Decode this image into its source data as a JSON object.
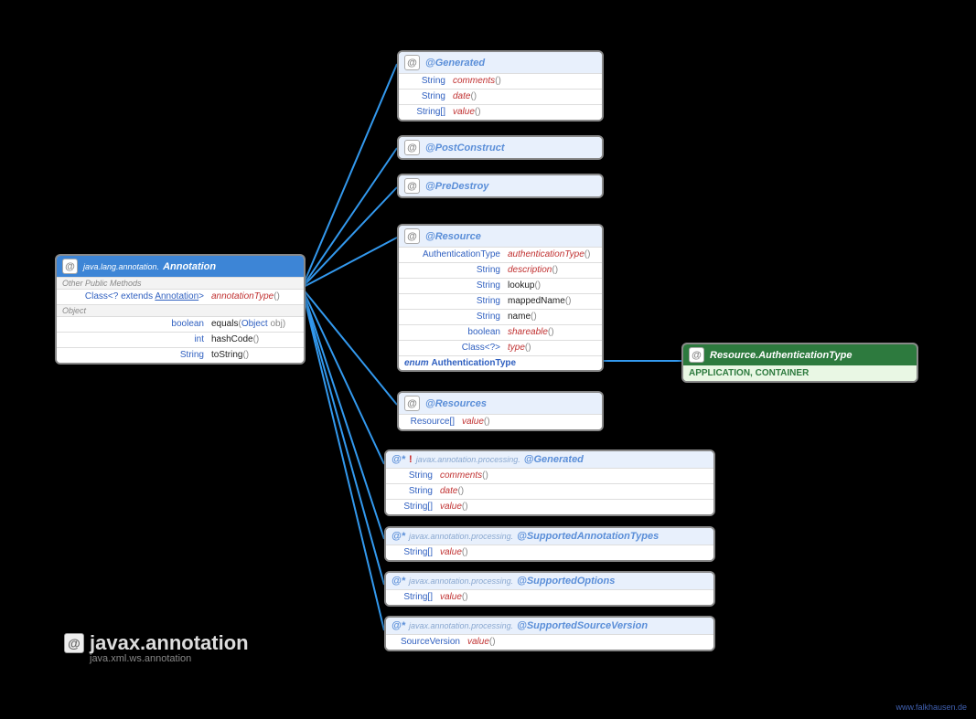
{
  "root": {
    "pkg": "java.lang.annotation.",
    "name": "Annotation",
    "section1": "Other Public Methods",
    "rows1": [
      {
        "type_pre": "Class<? extends ",
        "type_link": "Annotation",
        "type_post": ">",
        "name": "annotationType",
        "name_style": "red",
        "args": "()"
      }
    ],
    "section2": "Object",
    "rows2": [
      {
        "type": "boolean",
        "name": "equals",
        "args_pre": "(",
        "args_link": "Object",
        "args_post": " obj)"
      },
      {
        "type": "int",
        "name": "hashCode",
        "args": "()"
      },
      {
        "type": "String",
        "name": "toString",
        "args": "()"
      }
    ]
  },
  "generated": {
    "name": "@Generated",
    "rows": [
      {
        "type": "String",
        "name": "comments",
        "args": "()",
        "ns": "red"
      },
      {
        "type": "String",
        "name": "date",
        "args": "()",
        "ns": "red"
      },
      {
        "type": "String[]",
        "name": "value",
        "args": "()",
        "ns": "red"
      }
    ]
  },
  "postconstruct": {
    "name": "@PostConstruct"
  },
  "predestroy": {
    "name": "@PreDestroy"
  },
  "resource": {
    "name": "@Resource",
    "rows": [
      {
        "type": "AuthenticationType",
        "name": "authenticationType",
        "args": "()",
        "ns": "red"
      },
      {
        "type": "String",
        "name": "description",
        "args": "()",
        "ns": "red"
      },
      {
        "type": "String",
        "name": "lookup",
        "args": "()"
      },
      {
        "type": "String",
        "name": "mappedName",
        "args": "()"
      },
      {
        "type": "String",
        "name": "name",
        "args": "()"
      },
      {
        "type": "boolean",
        "name": "shareable",
        "args": "()",
        "ns": "red"
      },
      {
        "type": "Class<?>",
        "name": "type",
        "args": "()",
        "ns": "red"
      }
    ],
    "enum_kw": "enum",
    "enum_name": "AuthenticationType"
  },
  "authtype": {
    "name": "Resource.AuthenticationType",
    "values": "APPLICATION, CONTAINER"
  },
  "resources": {
    "name": "@Resources",
    "rows": [
      {
        "type": "Resource[]",
        "name": "value",
        "args": "()",
        "ns": "red"
      }
    ]
  },
  "pgen": {
    "pkg": "javax.annotation.processing.",
    "name": "@Generated",
    "bang": "!",
    "rows": [
      {
        "type": "String",
        "name": "comments",
        "args": "()",
        "ns": "red"
      },
      {
        "type": "String",
        "name": "date",
        "args": "()",
        "ns": "red"
      },
      {
        "type": "String[]",
        "name": "value",
        "args": "()",
        "ns": "red"
      }
    ]
  },
  "sat": {
    "pkg": "javax.annotation.processing.",
    "name": "@SupportedAnnotationTypes",
    "rows": [
      {
        "type": "String[]",
        "name": "value",
        "args": "()",
        "ns": "red"
      }
    ]
  },
  "sop": {
    "pkg": "javax.annotation.processing.",
    "name": "@SupportedOptions",
    "rows": [
      {
        "type": "String[]",
        "name": "value",
        "args": "()",
        "ns": "red"
      }
    ]
  },
  "ssv": {
    "pkg": "javax.annotation.processing.",
    "name": "@SupportedSourceVersion",
    "rows": [
      {
        "type": "SourceVersion",
        "name": "value",
        "args": "()",
        "ns": "red"
      }
    ]
  },
  "package": {
    "main": "javax.annotation",
    "sub": "java.xml.ws.annotation"
  },
  "credit": "www.falkhausen.de",
  "icons": {
    "at": "@",
    "at_star": "@*"
  }
}
